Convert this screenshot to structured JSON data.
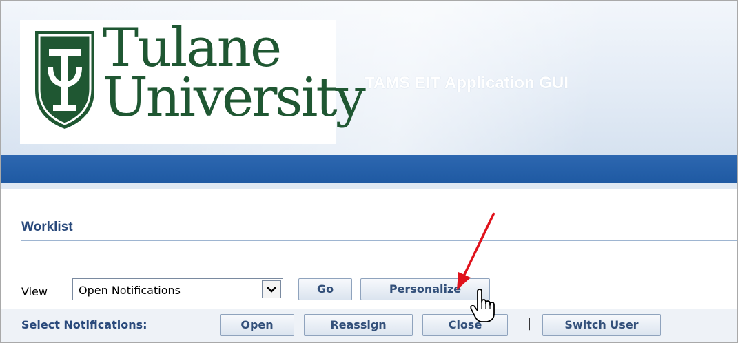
{
  "header": {
    "logo_line1": "Tulane",
    "logo_line2": "University",
    "app_title": "TAMS EIT Application GUI"
  },
  "worklist": {
    "title": "Worklist",
    "view_label": "View",
    "view_value": "Open Notifications",
    "go_label": "Go",
    "personalize_label": "Personalize"
  },
  "notifications": {
    "select_label": "Select Notifications:",
    "open_label": "Open",
    "reassign_label": "Reassign",
    "close_label": "Close",
    "separator": "|",
    "switch_user_label": "Switch User"
  },
  "icons": {
    "shield": "tulane-shield-icon",
    "dropdown": "chevron-down-icon",
    "annotation": "red-arrow-icon",
    "cursor": "hand-pointer-icon"
  },
  "colors": {
    "tulane_green": "#1f5732",
    "header_blue": "#1f5aa3",
    "annotation_red": "#e0121b"
  }
}
